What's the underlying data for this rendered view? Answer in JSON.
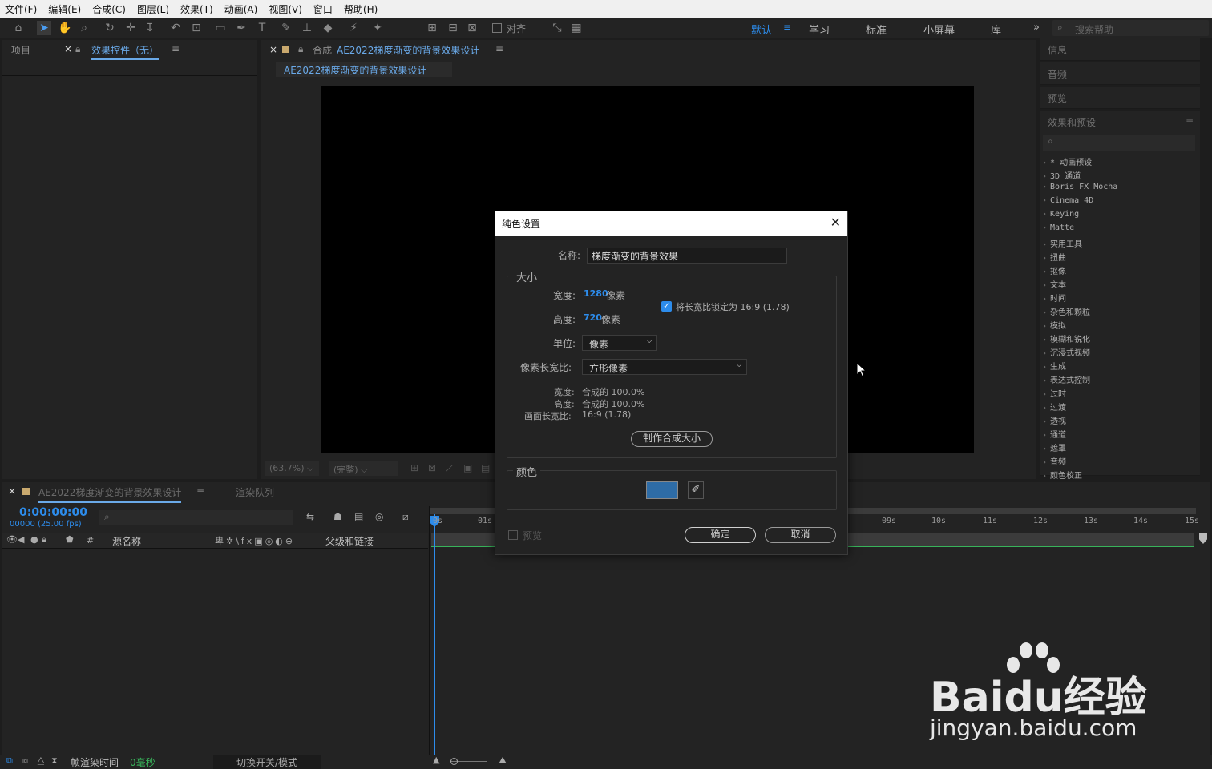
{
  "menu": [
    "文件(F)",
    "编辑(E)",
    "合成(C)",
    "图层(L)",
    "效果(T)",
    "动画(A)",
    "视图(V)",
    "窗口",
    "帮助(H)"
  ],
  "toolbar": {
    "align_label": "对齐",
    "workspaces": [
      "默认",
      "学习",
      "标准",
      "小屏幕",
      "库"
    ],
    "search_placeholder": "搜索帮助"
  },
  "left_panel": {
    "project_tab": "项目",
    "effects_tab": "效果控件（无）"
  },
  "comp_panel": {
    "prefix": "合成",
    "comp_name": "AE2022梯度渐变的背景效果设计",
    "sub_tab": "AE2022梯度渐变的背景效果设计",
    "zoom": "(63.7%)",
    "quality": "(完整)"
  },
  "right_panel": {
    "tabs": [
      "信息",
      "音频",
      "预览"
    ],
    "effects_title": "效果和预设",
    "effects": [
      "* 动画预设",
      "3D 通道",
      "Boris FX Mocha",
      "Cinema 4D",
      "Keying",
      "Matte",
      "实用工具",
      "扭曲",
      "抠像",
      "文本",
      "时间",
      "杂色和颗粒",
      "模拟",
      "模糊和锐化",
      "沉浸式视频",
      "生成",
      "表达式控制",
      "过时",
      "过渡",
      "透视",
      "通道",
      "遮罩",
      "音频",
      "颜色校正"
    ]
  },
  "timeline": {
    "tab": "AE2022梯度渐变的背景效果设计",
    "render_queue": "渲染队列",
    "timecode": "0:00:00:00",
    "frames": "00000 (25.00 fps)",
    "col_hash": "#",
    "col_source": "源名称",
    "col_parent": "父级和链接",
    "ticks": [
      "0s",
      "01s",
      "09s",
      "10s",
      "11s",
      "12s",
      "13s",
      "14s",
      "15s"
    ],
    "status_render": "帧渲染时间",
    "status_ms": "0毫秒",
    "toggle_label": "切换开关/模式"
  },
  "dialog": {
    "title": "纯色设置",
    "name_label": "名称:",
    "name_value": "梯度渐变的背景效果",
    "size_group": "大小",
    "width_label": "宽度:",
    "width_value": "1280",
    "width_unit": "像素",
    "height_label": "高度:",
    "height_value": "720",
    "height_unit": "像素",
    "lock_label": "将长宽比锁定为 16:9 (1.78)",
    "lock_checked": true,
    "unit_label": "单位:",
    "unit_value": "像素",
    "par_label": "像素长宽比:",
    "par_value": "方形像素",
    "info_width_label": "宽度:",
    "info_width_value": "合成的 100.0%",
    "info_height_label": "高度:",
    "info_height_value": "合成的 100.0%",
    "info_frame_label": "画面长宽比:",
    "info_frame_value": "16:9 (1.78)",
    "make_comp_size": "制作合成大小",
    "color_group": "颜色",
    "color_swatch": "#2e6ca6",
    "preview_label": "预览",
    "ok": "确定",
    "cancel": "取消"
  },
  "watermark": {
    "brand": "Baidu经验",
    "url": "jingyan.baidu.com"
  }
}
